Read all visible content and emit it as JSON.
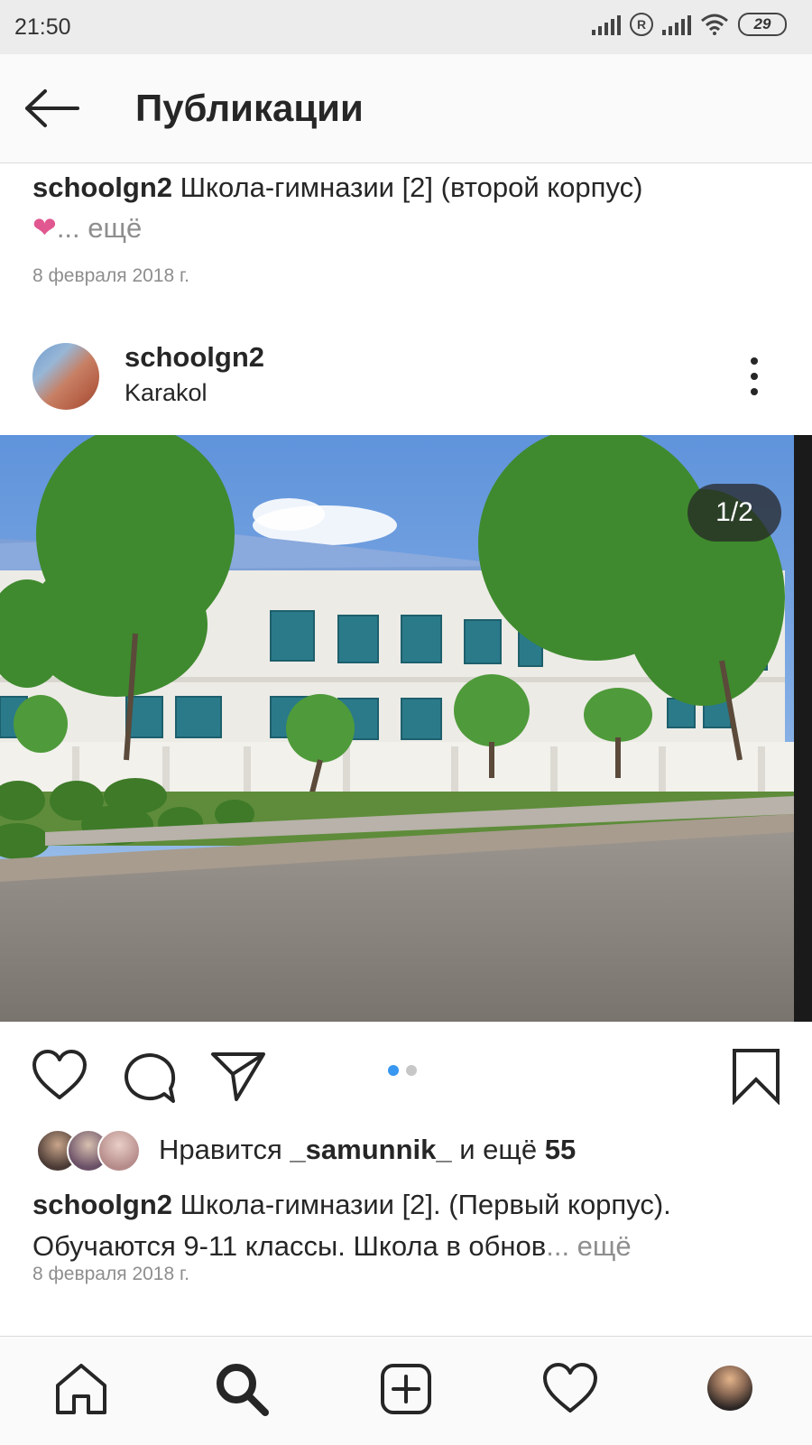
{
  "status_bar": {
    "time": "21:50",
    "battery": "29"
  },
  "header": {
    "title": "Публикации"
  },
  "prev_post": {
    "username": "schoolgn2",
    "caption": " Школа-гимназии [2] (второй корпус)",
    "heart": "❤",
    "more": "... ещё",
    "date": "8 февраля 2018 г."
  },
  "post": {
    "username": "schoolgn2",
    "location": "Karakol",
    "counter": "1/2",
    "likes_prefix": "Нравится ",
    "likes_user": "_samunnik_",
    "likes_mid": " и ещё ",
    "likes_count": "55",
    "caption_username": "schoolgn2",
    "caption_text": " Школа-гимназии [2]. (Первый корпус). Обучаются 9-11 классы. Школа в обнов",
    "caption_more": "... ещё",
    "date": "8 февраля 2018 г.",
    "carousel": {
      "current": 1,
      "total": 2
    }
  },
  "icons": {
    "back": "arrow-left-icon",
    "menu": "more-vertical-icon",
    "like": "heart-icon",
    "comment": "comment-icon",
    "share": "send-icon",
    "save": "bookmark-icon",
    "nav": [
      "home-icon",
      "search-icon",
      "add-icon",
      "activity-heart-icon",
      "profile-avatar"
    ]
  },
  "colors": {
    "accent": "#3897f0",
    "heart": "#e0588f",
    "muted": "#8e8e8e"
  }
}
